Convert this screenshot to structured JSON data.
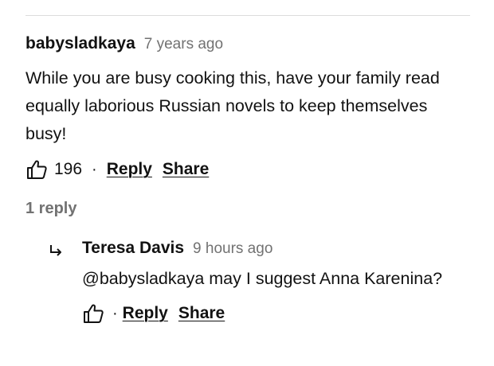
{
  "comment": {
    "author": "babysladkaya",
    "timestamp": "7 years ago",
    "text": "While you are busy cooking this, have your family read equally laborious Russian novels to keep themselves busy!",
    "likes": "196",
    "separator": "·",
    "reply_label": "Reply",
    "share_label": "Share",
    "replies_count_label": "1 reply"
  },
  "reply": {
    "author": "Teresa Davis",
    "timestamp": "9 hours ago",
    "text": "@babysladkaya may I suggest Anna Karenina?",
    "separator": "·",
    "reply_label": "Reply",
    "share_label": "Share"
  },
  "icons": {
    "like": "thumbs-up-icon",
    "reply_indicator": "reply-arrow-icon"
  }
}
